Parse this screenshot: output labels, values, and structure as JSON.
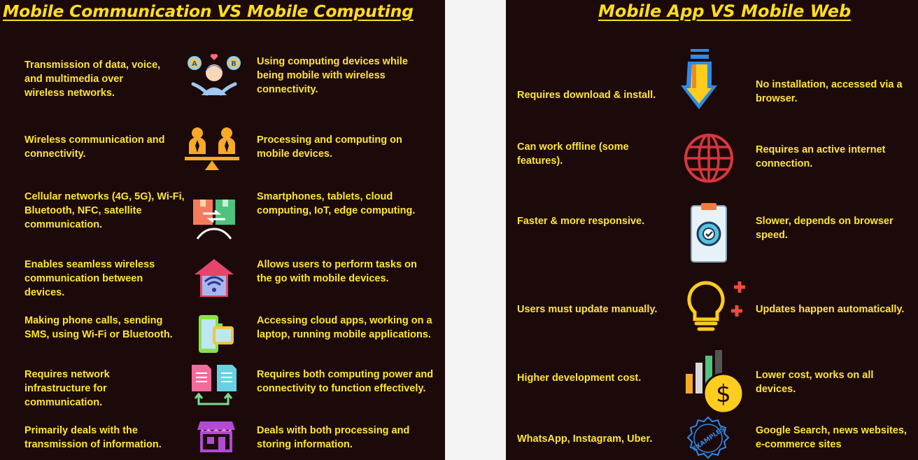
{
  "left": {
    "title": "Mobile  Communication VS  Mobile Computing",
    "rows": [
      {
        "communication": "Transmission of data, voice, and multimedia over wireless networks.",
        "icon": "person-choosing-icon",
        "computing": "Using computing devices while being mobile with wireless connectivity."
      },
      {
        "communication": "Wireless communication and connectivity.",
        "icon": "balance-people-icon",
        "computing": "Processing and computing on mobile devices."
      },
      {
        "communication": "Cellular networks (4G, 5G), Wi-Fi, Bluetooth, NFC, satellite communication.",
        "icon": "exchange-boxes-icon",
        "computing": "Smartphones, tablets, cloud computing, IoT, edge computing."
      },
      {
        "communication": "Enables seamless wireless communication between devices.",
        "icon": "wifi-home-icon",
        "computing": "Allows users to perform tasks on the go with mobile devices."
      },
      {
        "communication": "Making phone calls, sending SMS, using Wi-Fi or Bluetooth.",
        "icon": "phone-watch-icon",
        "computing": "Accessing cloud apps, working on a laptop, running mobile applications."
      },
      {
        "communication": "Requires network infrastructure for communication.",
        "icon": "file-transfer-icon",
        "computing": "Requires both computing power and connectivity to function effectively."
      },
      {
        "communication": "Primarily deals with the transmission of information.",
        "icon": "store-icon",
        "computing": "Deals with both processing and storing information."
      }
    ]
  },
  "right": {
    "title": "Mobile App VS  Mobile Web",
    "rows": [
      {
        "app": "Requires download & install.",
        "icon": "download-arrow-icon",
        "web": "No installation, accessed via a browser."
      },
      {
        "app": "Can work offline (some features).",
        "icon": "globe-icon",
        "web": "Requires an active internet connection."
      },
      {
        "app": "Faster & more responsive.",
        "icon": "clipboard-gear-icon",
        "web": "Slower, depends on browser speed."
      },
      {
        "app": "Users must update manually.",
        "icon": "lightbulb-plus-icon",
        "web": "Updates happen automatically."
      },
      {
        "app": "Higher development cost.",
        "icon": "cost-chart-icon",
        "web": "Lower cost, works on all devices."
      },
      {
        "app": "WhatsApp, Instagram, Uber.",
        "icon": "examples-stamp-icon",
        "web": "Google Search, news websites, e-commerce sites"
      }
    ],
    "stamp_text": "EXAMPLES"
  }
}
